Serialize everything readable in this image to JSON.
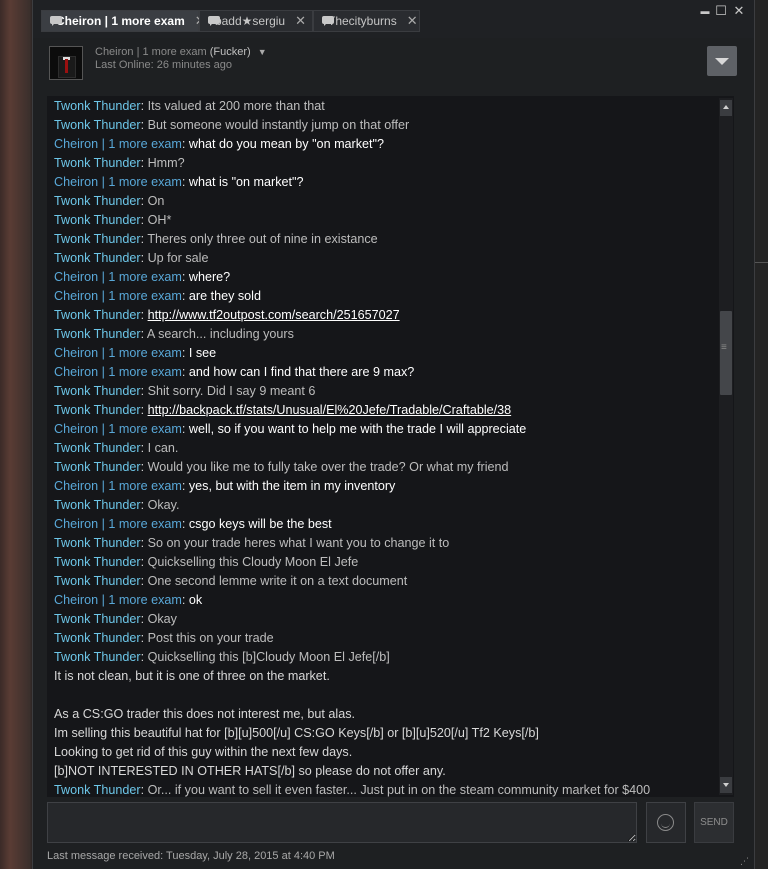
{
  "tabs": [
    {
      "label": "Cheiron | 1 more exam",
      "active": true
    },
    {
      "label": "badd★sergiu",
      "active": false
    },
    {
      "label": "Thecityburns",
      "active": false
    }
  ],
  "window_controls": {
    "minimize": "▬",
    "maximize": "☐",
    "close": "✕",
    "tab_close": "✕"
  },
  "header": {
    "name": "Cheiron | 1 more exam",
    "nickname": "(Fucker)",
    "status": "Last Online: 26 minutes ago",
    "caret": "▼"
  },
  "messages": [
    {
      "sender": "Twonk Thunder",
      "role": "friend",
      "text": "Its valued at 200 more than that"
    },
    {
      "sender": "Twonk Thunder",
      "role": "friend",
      "text": "But someone would instantly jump on that offer"
    },
    {
      "sender": "Cheiron | 1 more exam",
      "role": "self",
      "text": "what do you mean by \"on market\"?"
    },
    {
      "sender": "Twonk Thunder",
      "role": "friend",
      "text": "Hmm?"
    },
    {
      "sender": "Cheiron | 1 more exam",
      "role": "self",
      "text": "what is \"on market\"?"
    },
    {
      "sender": "Twonk Thunder",
      "role": "friend",
      "text": "On"
    },
    {
      "sender": "Twonk Thunder",
      "role": "friend",
      "text": "OH*"
    },
    {
      "sender": "Twonk Thunder",
      "role": "friend",
      "text": "Theres only three out of nine in existance"
    },
    {
      "sender": "Twonk Thunder",
      "role": "friend",
      "text": "Up for sale"
    },
    {
      "sender": "Cheiron | 1 more exam",
      "role": "self",
      "text": "where?"
    },
    {
      "sender": "Cheiron | 1 more exam",
      "role": "self",
      "text": "are they sold"
    },
    {
      "sender": "Twonk Thunder",
      "role": "friend",
      "link": "http://www.tf2outpost.com/search/251657027"
    },
    {
      "sender": "Twonk Thunder",
      "role": "friend",
      "text": "A search... including yours"
    },
    {
      "sender": "Cheiron | 1 more exam",
      "role": "self",
      "text": "I see"
    },
    {
      "sender": "Cheiron | 1 more exam",
      "role": "self",
      "text": "and how can I find that there are 9 max?"
    },
    {
      "sender": "Twonk Thunder",
      "role": "friend",
      "text": "Shit sorry. Did I say 9 meant 6"
    },
    {
      "sender": "Twonk Thunder",
      "role": "friend",
      "link": "http://backpack.tf/stats/Unusual/El%20Jefe/Tradable/Craftable/38"
    },
    {
      "sender": "Cheiron | 1 more exam",
      "role": "self",
      "text": "well, so if you want to help me with the trade I will appreciate"
    },
    {
      "sender": "Twonk Thunder",
      "role": "friend",
      "text": "I can."
    },
    {
      "sender": "Twonk Thunder",
      "role": "friend",
      "text": "Would you like me to fully take over the trade? Or what my friend"
    },
    {
      "sender": "Cheiron | 1 more exam",
      "role": "self",
      "text": "yes, but with the item in my inventory"
    },
    {
      "sender": "Twonk Thunder",
      "role": "friend",
      "text": "Okay."
    },
    {
      "sender": "Cheiron | 1 more exam",
      "role": "self",
      "text": "csgo keys will be the best"
    },
    {
      "sender": "Twonk Thunder",
      "role": "friend",
      "text": "So on your trade heres what I want you to change it to"
    },
    {
      "sender": "Twonk Thunder",
      "role": "friend",
      "text": "Quickselling this Cloudy Moon El Jefe"
    },
    {
      "sender": "Twonk Thunder",
      "role": "friend",
      "text": "One second lemme write it on a text document"
    },
    {
      "sender": "Cheiron | 1 more exam",
      "role": "self",
      "text": "ok"
    },
    {
      "sender": "Twonk Thunder",
      "role": "friend",
      "text": "Okay"
    },
    {
      "sender": "Twonk Thunder",
      "role": "friend",
      "text": "Post this on your trade"
    },
    {
      "sender": "Twonk Thunder",
      "role": "friend",
      "text": "Quickselling this [b]Cloudy Moon El Jefe[/b]"
    },
    {
      "plain": "It is not clean, but it is one of three on the market."
    },
    {
      "plain": ""
    },
    {
      "plain": "As a CS:GO trader this does not interest me, but alas."
    },
    {
      "plain": "Im selling this beautiful hat for [b][u]500[/u] CS:GO Keys[/b] or [b][u]520[/u] Tf2 Keys[/b]"
    },
    {
      "plain": "Looking to get rid of this guy within the next few days."
    },
    {
      "plain": "[b]NOT INTERESTED IN OTHER HATS[/b] so please do not offer any."
    },
    {
      "sender": "Twonk Thunder",
      "role": "friend",
      "text": "Or... if you want to sell it even faster... Just put in on the steam community market for $400"
    }
  ],
  "input": {
    "value": "",
    "send_label": "SEND"
  },
  "footer": {
    "last_message": "Last message received: Tuesday, July 28, 2015 at 4:40 PM"
  }
}
